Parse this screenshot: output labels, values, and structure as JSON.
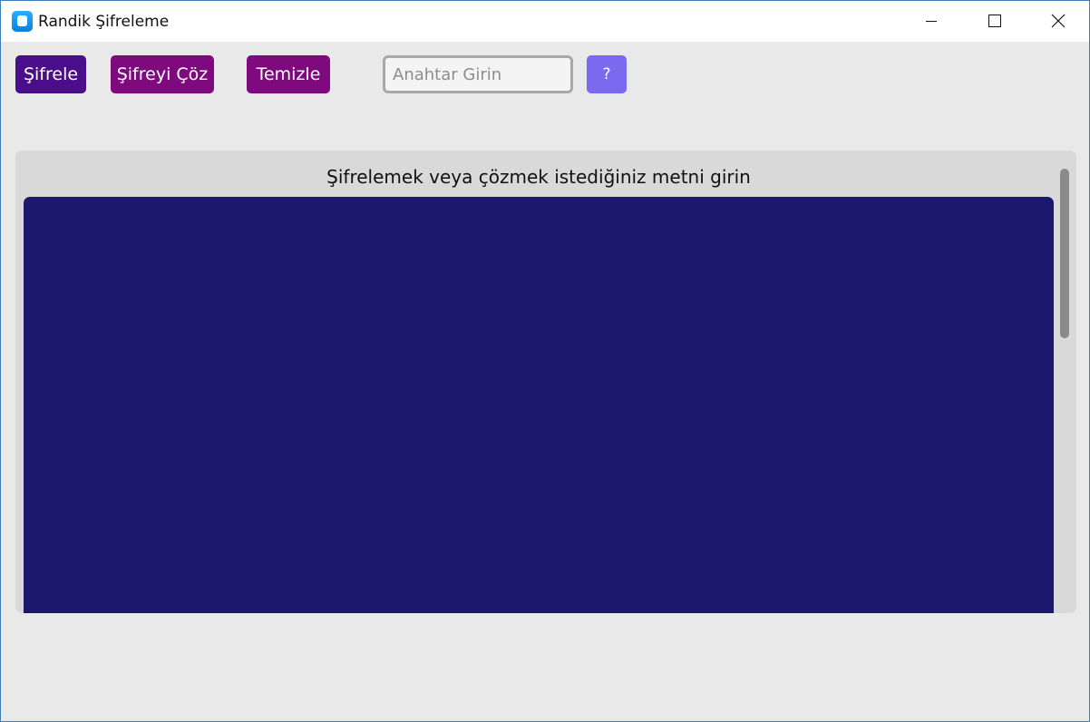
{
  "window": {
    "title": "Randik Şifreleme"
  },
  "toolbar": {
    "encrypt_label": "Şifrele",
    "decrypt_label": "Şifreyi Çöz",
    "clear_label": "Temizle",
    "key_placeholder": "Anahtar Girin",
    "key_value": "",
    "help_label": "?"
  },
  "main": {
    "prompt_label": "Şifrelemek veya çözmek istediğiniz metni girin",
    "text_value": ""
  },
  "colors": {
    "encrypt_button": "#4b0e8a",
    "decrypt_button": "#7e0a7e",
    "clear_button": "#7e0a7e",
    "help_button": "#7b6af0",
    "textarea_background": "#1a196e",
    "panel_background": "#d9d9d9",
    "window_background": "#e9e9e9"
  },
  "icons": {
    "app": "app-icon",
    "minimize": "minimize-icon",
    "maximize": "maximize-icon",
    "close": "close-icon"
  }
}
